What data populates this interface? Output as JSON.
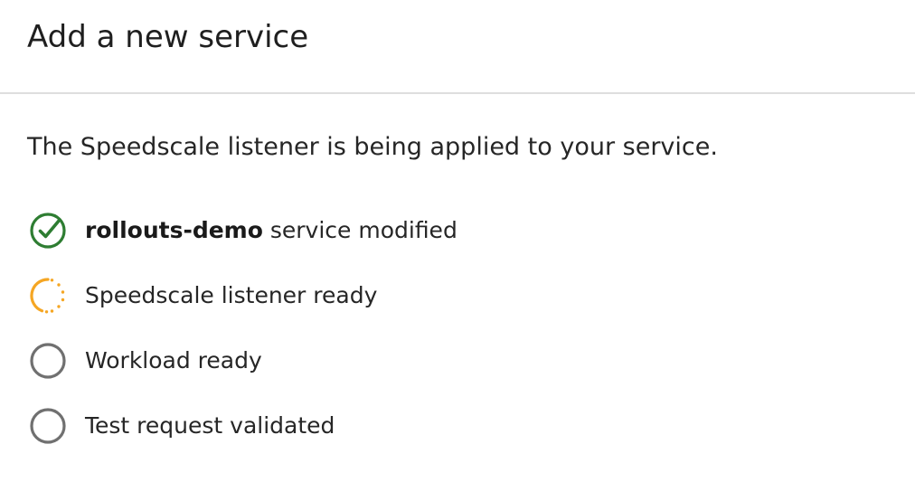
{
  "header": {
    "title": "Add a new service"
  },
  "main": {
    "description": "The Speedscale listener is being applied to your service.",
    "steps": [
      {
        "status": "complete",
        "icon": "check-circle-icon",
        "bold": "rollouts-demo",
        "label": " service modified"
      },
      {
        "status": "in-progress",
        "icon": "spinner-icon",
        "label": "Speedscale listener ready"
      },
      {
        "status": "pending",
        "icon": "empty-circle-icon",
        "label": "Workload ready"
      },
      {
        "status": "pending",
        "icon": "empty-circle-icon",
        "label": "Test request validated"
      }
    ]
  },
  "colors": {
    "complete": "#2e7d32",
    "in_progress": "#f5a623",
    "pending": "#707070",
    "divider": "#dedede"
  }
}
